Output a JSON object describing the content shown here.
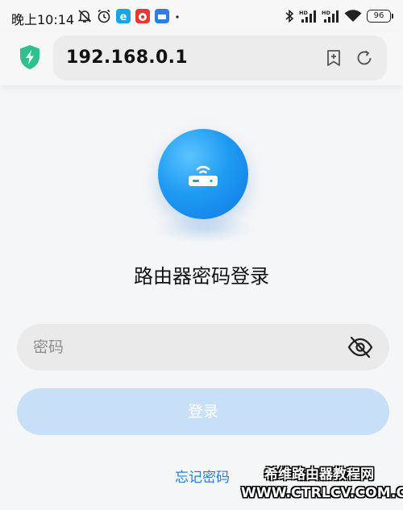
{
  "status_bar": {
    "time": "晚上10:14",
    "battery": "96",
    "icons": [
      "mute-bell-icon",
      "alarm-icon",
      "app-icon-e",
      "app-icon-red",
      "app-icon-blue",
      "dot",
      "bluetooth-icon",
      "hd-signal-icon",
      "hd-signal-icon",
      "wifi-icon",
      "battery-icon"
    ]
  },
  "address_bar": {
    "url": "192.168.0.1",
    "icons": [
      "shield-bolt-icon",
      "bookmark-add-icon",
      "refresh-icon"
    ]
  },
  "login": {
    "title": "路由器密码登录",
    "password_placeholder": "密码",
    "password_value": "",
    "login_button": "登录",
    "forgot_link": "忘记密码",
    "icons": [
      "router-logo-icon",
      "eye-off-icon"
    ]
  },
  "watermark": {
    "line1": "希维路由器教程网",
    "line2": "WWW.CTRLCV.COM.CN"
  },
  "colors": {
    "accent": "#1f9bf2",
    "button_disabled": "#c7e0f8",
    "link": "#2b7bd8",
    "shield": "#2fc08d"
  }
}
